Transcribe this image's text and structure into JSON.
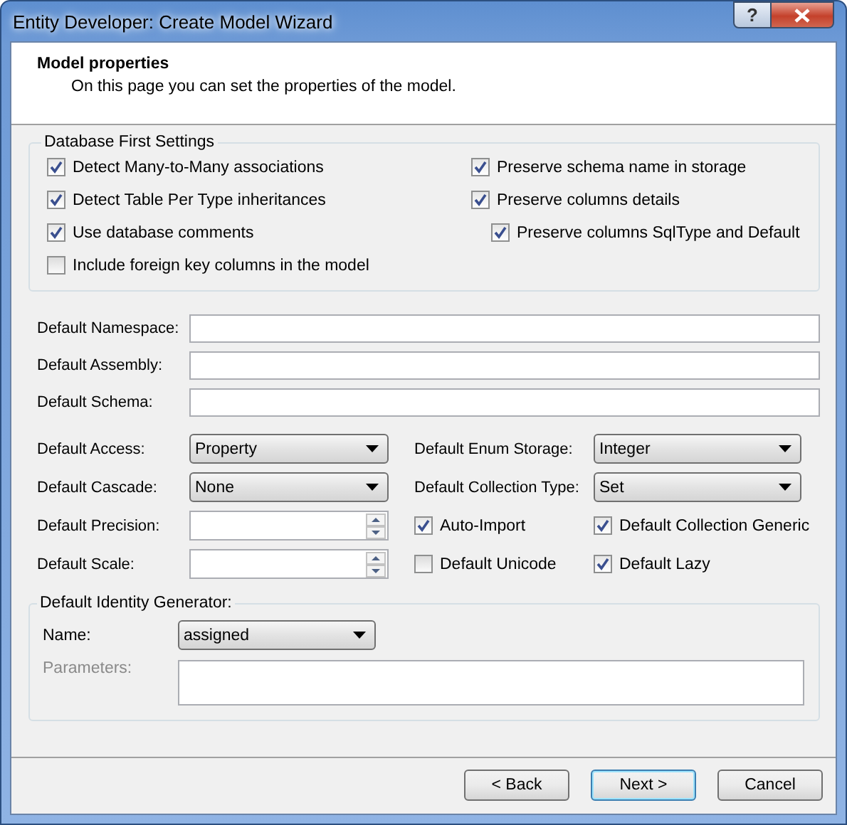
{
  "window": {
    "title": "Entity Developer: Create Model Wizard",
    "help_button": "?"
  },
  "header": {
    "title": "Model properties",
    "description": "On this page you can set the properties of the model."
  },
  "database_first_settings": {
    "legend": "Database First Settings",
    "left_options": [
      {
        "label": "Detect Many-to-Many associations",
        "checked": true
      },
      {
        "label": "Detect Table Per Type inheritances",
        "checked": true
      },
      {
        "label": "Use database comments",
        "checked": true
      },
      {
        "label": "Include foreign key columns in the model",
        "checked": false
      }
    ],
    "right_options": [
      {
        "label": "Preserve schema name in storage",
        "checked": true
      },
      {
        "label": "Preserve columns details",
        "checked": true,
        "children": [
          {
            "label": "Preserve columns SqlType and Default",
            "checked": true
          }
        ]
      }
    ]
  },
  "text_fields": [
    {
      "label": "Default Namespace:"
    },
    {
      "label": "Default Assembly:"
    },
    {
      "label": "Default Schema:"
    }
  ],
  "settings_rows": [
    [
      {
        "kind": "combo",
        "label": "Default Access:",
        "value": "Property"
      },
      {
        "kind": "combo",
        "label": "Default Enum Storage:",
        "value": "Integer"
      }
    ],
    [
      {
        "kind": "combo",
        "label": "Default Cascade:",
        "value": "None"
      },
      {
        "kind": "combo",
        "label": "Default Collection Type:",
        "value": "Set"
      }
    ],
    [
      {
        "kind": "spin",
        "label": "Default Precision:"
      },
      {
        "kind": "check",
        "label": "Auto-Import",
        "checked": true
      },
      {
        "kind": "check",
        "label": "Default Collection Generic",
        "checked": true
      }
    ],
    [
      {
        "kind": "spin",
        "label": "Default Scale:"
      },
      {
        "kind": "check",
        "label": "Default Unicode",
        "checked": false
      },
      {
        "kind": "check",
        "label": "Default Lazy",
        "checked": true
      }
    ]
  ],
  "identity_generator": {
    "legend": "Default Identity Generator:",
    "name_label": "Name:",
    "name_value": "assigned",
    "parameters_label": "Parameters:",
    "parameters_disabled": true
  },
  "buttons": [
    {
      "label": "< Back",
      "default": false
    },
    {
      "label": "Next >",
      "default": true
    },
    {
      "label": "Cancel",
      "default": false
    }
  ]
}
